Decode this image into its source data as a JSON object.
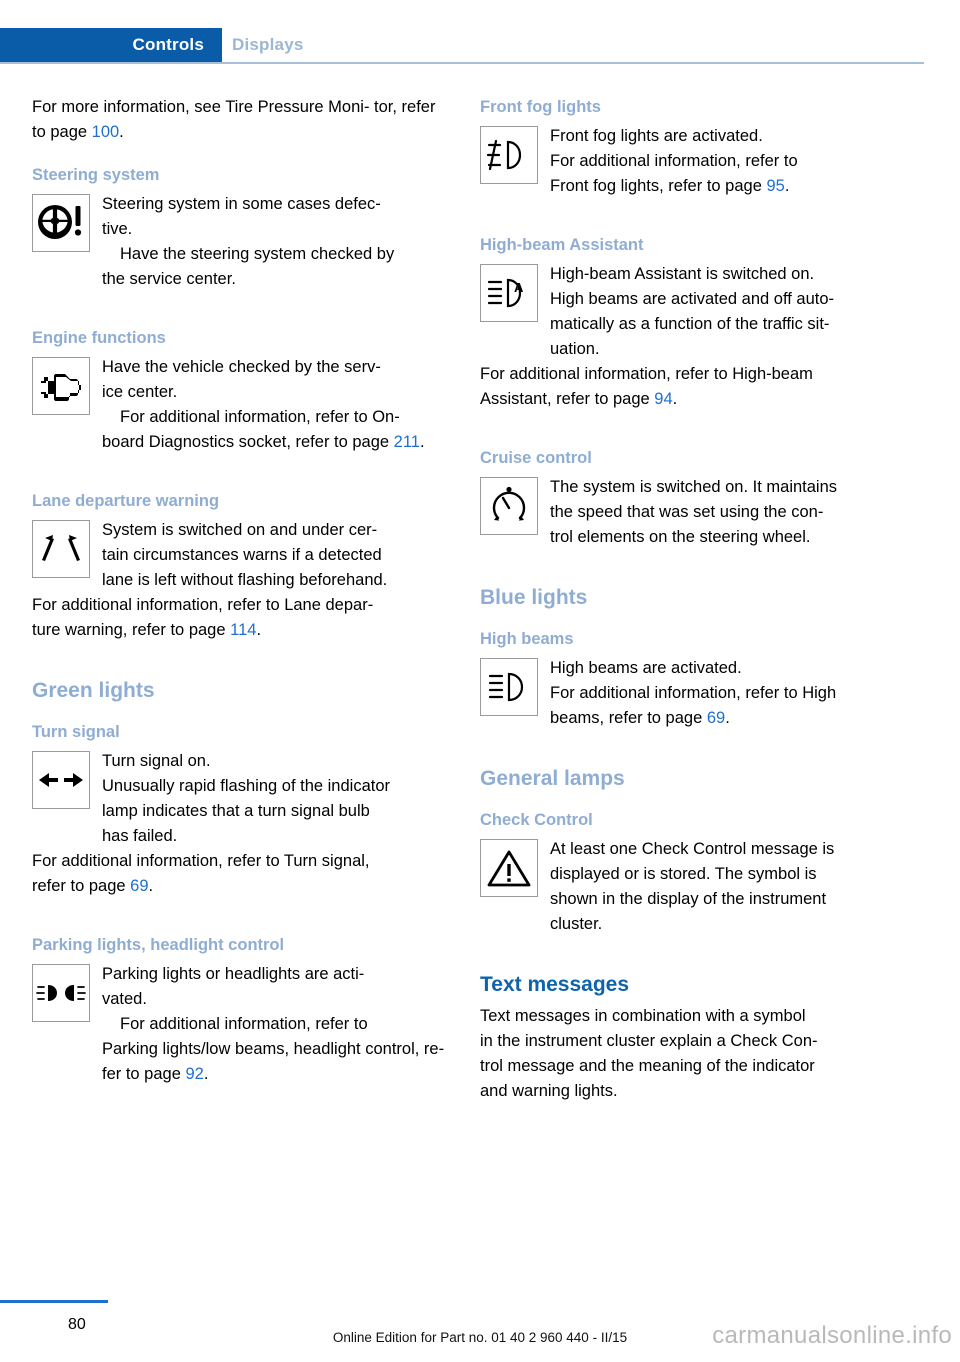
{
  "tabs": [
    {
      "label": "Controls",
      "active": true
    },
    {
      "label": "Displays",
      "active": false
    }
  ],
  "colors": {
    "tab_active_bg": "#0a5ca8",
    "tab_inactive_text": "#9db6d4",
    "h1_blue": "#0d63ac",
    "h2_blue": "#8fadd2",
    "link_blue": "#1f6fd0",
    "footer_rule": "#1f6fd0",
    "watermark": "#b9b9b9",
    "icon_border": "#9a9a9a"
  },
  "left_column": {
    "intro": {
      "text_before": "For more information, see Tire Pressure Moni-\ntor, refer to page ",
      "page_ref": "100",
      "text_after": "."
    },
    "steering_system": {
      "heading": "Steering system",
      "icon": "steering-wheel-warning-icon",
      "body1": "Steering system in some cases defec-\ntive.",
      "body2": "Have the steering system checked by\nthe service center."
    },
    "engine_functions": {
      "heading": "Engine functions",
      "icon": "engine-check-icon",
      "body1": "Have the vehicle checked by the serv-\nice center.",
      "body2_before": "For additional information, refer to On-\nboard Diagnostics socket, refer to page ",
      "page_ref": "211",
      "body2_after": "."
    },
    "lane_departure_warning": {
      "heading": "Lane departure warning",
      "icon": "lane-departure-icon",
      "body1": "System is switched on and under cer-\ntain circumstances warns if a detected\nlane is left without flashing beforehand.",
      "body2_before": "For additional information, refer to Lane depar-\nture warning, refer to page ",
      "page_ref": "114",
      "body2_after": "."
    },
    "green_lights": {
      "heading": "Green lights"
    },
    "turn_signal": {
      "heading": "Turn signal",
      "icon": "turn-signal-arrows-icon",
      "body1": "Turn signal on.",
      "body2": "Unusually rapid flashing of the indicator\nlamp indicates that a turn signal bulb\nhas failed.",
      "body3_before": "For additional information, refer to Turn signal,\nrefer to page ",
      "page_ref": "69",
      "body3_after": "."
    },
    "parking_lights": {
      "heading": "Parking lights, headlight control",
      "icon": "parking-lights-icon",
      "body1": "Parking lights or headlights are acti-\nvated.",
      "body2_before": "For additional information, refer to\nParking lights/low beams, headlight control, re-\nfer to page ",
      "page_ref": "92",
      "body2_after": "."
    }
  },
  "right_column": {
    "front_fog_lights": {
      "heading": "Front fog lights",
      "icon": "front-fog-light-icon",
      "body1": "Front fog lights are activated.",
      "body2_before": "For additional information, refer to\nFront fog lights, refer to page ",
      "page_ref": "95",
      "body2_after": "."
    },
    "high_beam_assistant": {
      "heading": "High-beam Assistant",
      "icon": "high-beam-assistant-icon",
      "body1": "High-beam Assistant is switched on.",
      "body2": "High beams are activated and off auto-\nmatically as a function of the traffic sit-\nuation.",
      "body3_before": "For additional information, refer to High-beam\nAssistant, refer to page ",
      "page_ref": "94",
      "body3_after": "."
    },
    "cruise_control": {
      "heading": "Cruise control",
      "icon": "cruise-control-gauge-icon",
      "body1": "The system is switched on. It maintains\nthe speed that was set using the con-\ntrol elements on the steering wheel."
    },
    "blue_lights": {
      "heading": "Blue lights"
    },
    "high_beams": {
      "heading": "High beams",
      "icon": "high-beam-icon",
      "body1": "High beams are activated.",
      "body2_before": "For additional information, refer to High\nbeams, refer to page ",
      "page_ref": "69",
      "body2_after": "."
    },
    "general_lamps": {
      "heading": "General lamps"
    },
    "check_control": {
      "heading": "Check Control",
      "icon": "warning-triangle-icon",
      "body1": "At least one Check Control message is\ndisplayed or is stored. The symbol is\nshown in the display of the instrument\ncluster."
    },
    "text_messages": {
      "heading": "Text messages",
      "body": "Text messages in combination with a symbol\nin the instrument cluster explain a Check Con-\ntrol message and the meaning of the indicator\nand warning lights."
    }
  },
  "footer": {
    "page_number": "80",
    "edition": "Online Edition for Part no. 01 40 2 960 440 - II/15",
    "watermark": "carmanualsonline.info"
  }
}
